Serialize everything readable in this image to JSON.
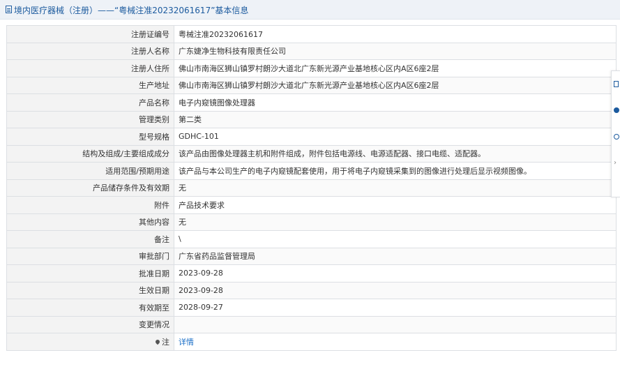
{
  "header": {
    "title": "境内医疗器械（注册）——“粤械注准20232061617”基本信息"
  },
  "rows": [
    {
      "label": "注册证编号",
      "value": "粤械注准20232061617"
    },
    {
      "label": "注册人名称",
      "value": "广东婕净生物科技有限责任公司"
    },
    {
      "label": "注册人住所",
      "value": "佛山市南海区狮山镇罗村朗沙大道北广东新光源产业基地核心区内A区6座2层"
    },
    {
      "label": "生产地址",
      "value": "佛山市南海区狮山镇罗村朗沙大道北广东新光源产业基地核心区内A区6座2层"
    },
    {
      "label": "产品名称",
      "value": "电子内窥镜图像处理器"
    },
    {
      "label": "管理类别",
      "value": "第二类"
    },
    {
      "label": "型号规格",
      "value": "GDHC-101"
    },
    {
      "label": "结构及组成/主要组成成分",
      "value": "该产品由图像处理器主机和附件组成，附件包括电源线、电源适配器、接口电缆、适配器。"
    },
    {
      "label": "适用范围/预期用途",
      "value": "该产品与本公司生产的电子内窥镜配套使用，用于将电子内窥镜采集到的图像进行处理后显示视频图像。"
    },
    {
      "label": "产品储存条件及有效期",
      "value": "无"
    },
    {
      "label": "附件",
      "value": "产品技术要求"
    },
    {
      "label": "其他内容",
      "value": "无"
    },
    {
      "label": "备注",
      "value": "\\"
    },
    {
      "label": "审批部门",
      "value": "广东省药品监督管理局"
    },
    {
      "label": "批准日期",
      "value": "2023-09-28"
    },
    {
      "label": "生效日期",
      "value": "2023-09-28"
    },
    {
      "label": "有效期至",
      "value": "2028-09-27"
    },
    {
      "label": "变更情况",
      "value": ""
    }
  ],
  "note": {
    "label": "注",
    "link_text": "详情",
    "icon": "pin-icon"
  },
  "side_toolbar": {
    "icons": [
      "document-icon",
      "info-icon",
      "share-icon",
      "close-icon"
    ]
  }
}
